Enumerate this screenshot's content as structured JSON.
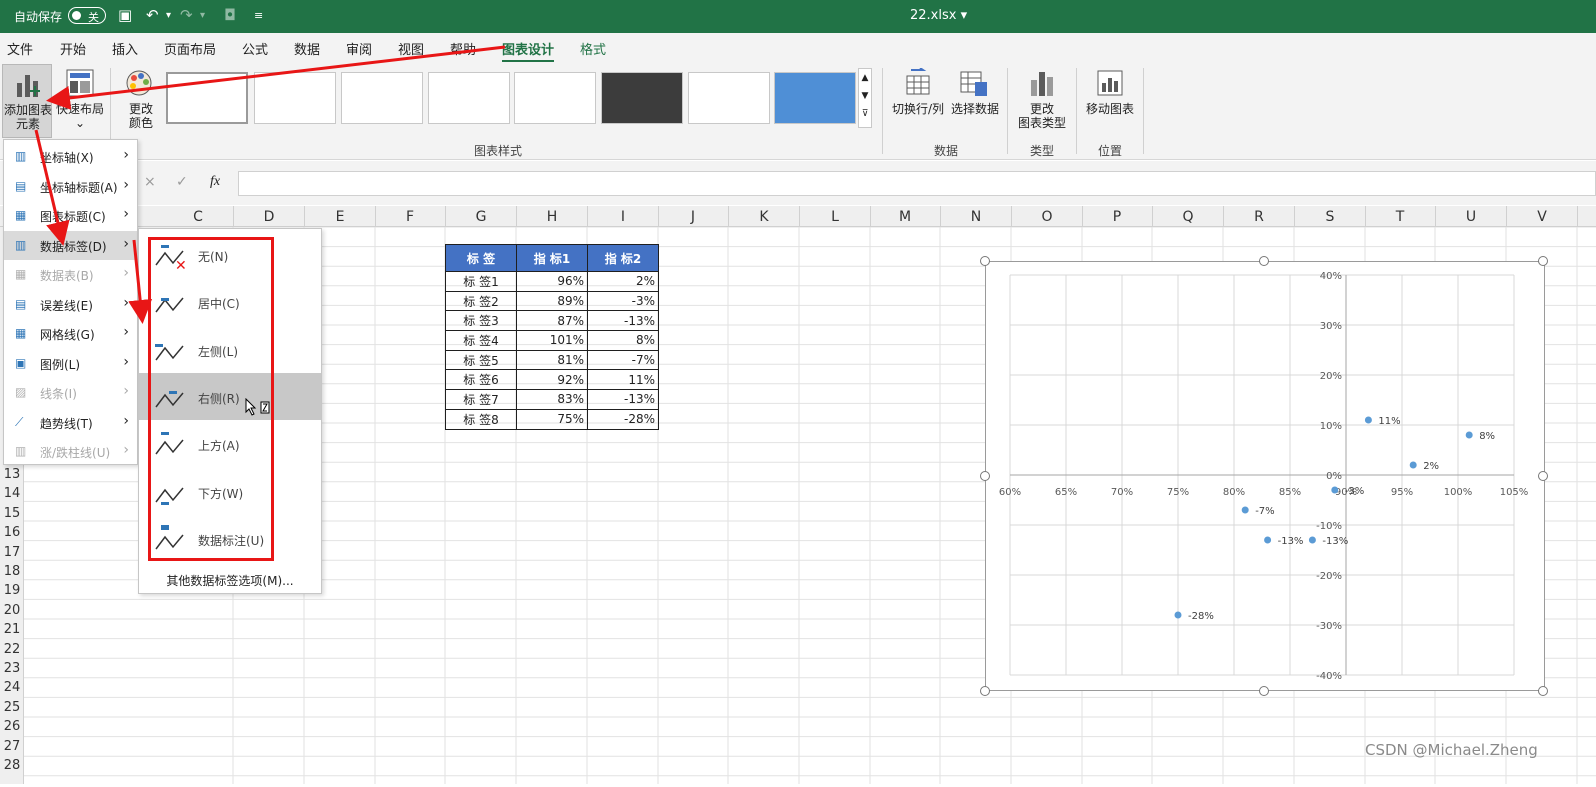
{
  "titlebar": {
    "autosave_label": "自动保存",
    "toggle_state": "关",
    "filename": "22.xlsx"
  },
  "menu_tabs": [
    "文件",
    "开始",
    "插入",
    "页面布局",
    "公式",
    "数据",
    "审阅",
    "视图",
    "帮助",
    "图表设计",
    "格式"
  ],
  "ribbon": {
    "add_element": "添加图表\n元素",
    "quick_layout": "快速布局",
    "change_colors": "更改\n颜色",
    "chart_styles_label": "图表样式",
    "switch_rowcol": "切换行/列",
    "select_data": "选择数据",
    "data_group_label": "数据",
    "change_type": "更改\n图表类型",
    "type_group_label": "类型",
    "move_chart": "移动图表",
    "location_group_label": "位置"
  },
  "formula": {
    "fx": "fx",
    "cancel": "×",
    "confirm": "✓"
  },
  "columns": [
    "C",
    "D",
    "E",
    "F",
    "G",
    "H",
    "I",
    "J",
    "K",
    "L",
    "M",
    "N",
    "O",
    "P",
    "Q",
    "R",
    "S",
    "T",
    "U",
    "V"
  ],
  "rows": [
    "13",
    "14",
    "15",
    "16",
    "17",
    "18",
    "19",
    "20",
    "21",
    "22",
    "23",
    "24",
    "25",
    "26",
    "27",
    "28"
  ],
  "table": {
    "headers": [
      "标 签",
      "指 标1",
      "指 标2"
    ],
    "rows": [
      [
        "标 签1",
        "96%",
        "2%"
      ],
      [
        "标 签2",
        "89%",
        "-3%"
      ],
      [
        "标 签3",
        "87%",
        "-13%"
      ],
      [
        "标 签4",
        "101%",
        "8%"
      ],
      [
        "标 签5",
        "81%",
        "-7%"
      ],
      [
        "标 签6",
        "92%",
        "11%"
      ],
      [
        "标 签7",
        "83%",
        "-13%"
      ],
      [
        "标 签8",
        "75%",
        "-28%"
      ]
    ]
  },
  "dropdown_main": [
    {
      "label": "坐标轴(X)",
      "disabled": false
    },
    {
      "label": "坐标轴标题(A)",
      "disabled": false
    },
    {
      "label": "图表标题(C)",
      "disabled": false
    },
    {
      "label": "数据标签(D)",
      "disabled": false,
      "hover": true
    },
    {
      "label": "数据表(B)",
      "disabled": true
    },
    {
      "label": "误差线(E)",
      "disabled": false
    },
    {
      "label": "网格线(G)",
      "disabled": false
    },
    {
      "label": "图例(L)",
      "disabled": false
    },
    {
      "label": "线条(I)",
      "disabled": true
    },
    {
      "label": "趋势线(T)",
      "disabled": false
    },
    {
      "label": "涨/跌柱线(U)",
      "disabled": true
    }
  ],
  "dropdown_labels": [
    {
      "label": "无(N)"
    },
    {
      "label": "居中(C)"
    },
    {
      "label": "左侧(L)"
    },
    {
      "label": "右侧(R)",
      "hover": true
    },
    {
      "label": "上方(A)"
    },
    {
      "label": "下方(W)"
    },
    {
      "label": "数据标注(U)"
    }
  ],
  "more_options": "其他数据标签选项(M)...",
  "chart_data": {
    "type": "scatter",
    "series": [
      {
        "points": [
          {
            "x": 96,
            "y": 2,
            "label": "2%"
          },
          {
            "x": 89,
            "y": -3,
            "label": "-3%"
          },
          {
            "x": 87,
            "y": -13,
            "label": "-13%"
          },
          {
            "x": 101,
            "y": 8,
            "label": "8%"
          },
          {
            "x": 81,
            "y": -7,
            "label": "-7%"
          },
          {
            "x": 92,
            "y": 11,
            "label": "11%"
          },
          {
            "x": 83,
            "y": -13,
            "label": "-13%"
          },
          {
            "x": 75,
            "y": -28,
            "label": "-28%"
          }
        ]
      }
    ],
    "xlim": [
      60,
      105
    ],
    "ylim": [
      -40,
      40
    ],
    "xticks": [
      "60%",
      "65%",
      "70%",
      "75%",
      "80%",
      "85%",
      "90%",
      "95%",
      "100%",
      "105%"
    ],
    "yticks": [
      "40%",
      "30%",
      "20%",
      "10%",
      "0%",
      "-10%",
      "-20%",
      "-30%",
      "-40%"
    ],
    "grid": true,
    "point_color": "#5b9bd5"
  },
  "watermark": "CSDN @Michael.Zheng",
  "colors": {
    "excel_green": "#217346",
    "header_blue": "#4472c4",
    "annotation_red": "#e81616"
  }
}
